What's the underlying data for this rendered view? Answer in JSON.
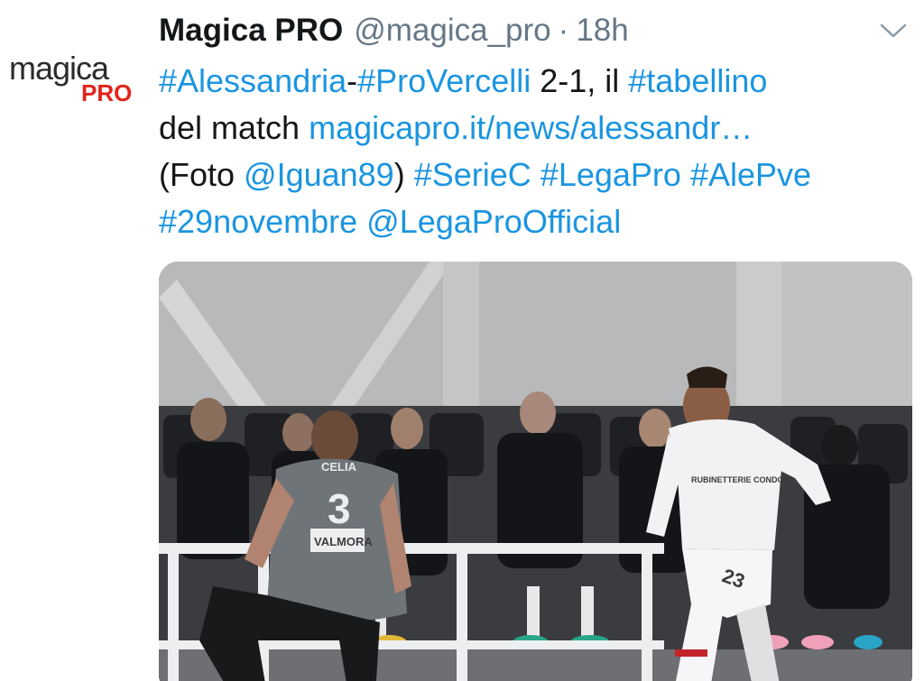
{
  "tweet": {
    "author_name": "Magica PRO",
    "handle": "@magica_pro",
    "separator": "·",
    "time": "18h",
    "menu_icon": "chevron-down-icon",
    "avatar": {
      "logo_top": "magica",
      "logo_bottom": "PRO",
      "brand_color": "#e2231a"
    },
    "body": {
      "line1": {
        "hashtag1": "#Alessandria",
        "dash": "-",
        "hashtag2": "#ProVercelli",
        "score": " 2-1, il ",
        "hashtag3": "#tabellino"
      },
      "line2": {
        "text": "del match ",
        "link": "magicapro.it/news/alessandr…"
      },
      "line3": {
        "open": "(Foto ",
        "mention": "@Iguan89",
        "close": ") ",
        "hashtag1": "#SerieC",
        "sp1": " ",
        "hashtag2": "#LegaPro",
        "sp2": " ",
        "hashtag3": "#AlePve"
      },
      "line4": {
        "hashtag": "#29novembre",
        "sp": " ",
        "mention": "@LegaProOfficial"
      }
    },
    "media": {
      "description_icon": "photo-football-match",
      "player1_name": "CELIA",
      "player1_number": "3",
      "player1_sponsor": "VALMORA",
      "player2_number": "23",
      "player2_sponsor": "RUBINETTERIE CONDOR"
    },
    "colors": {
      "link": "#1b95e0",
      "text": "#14171a",
      "muted": "#657786"
    }
  }
}
